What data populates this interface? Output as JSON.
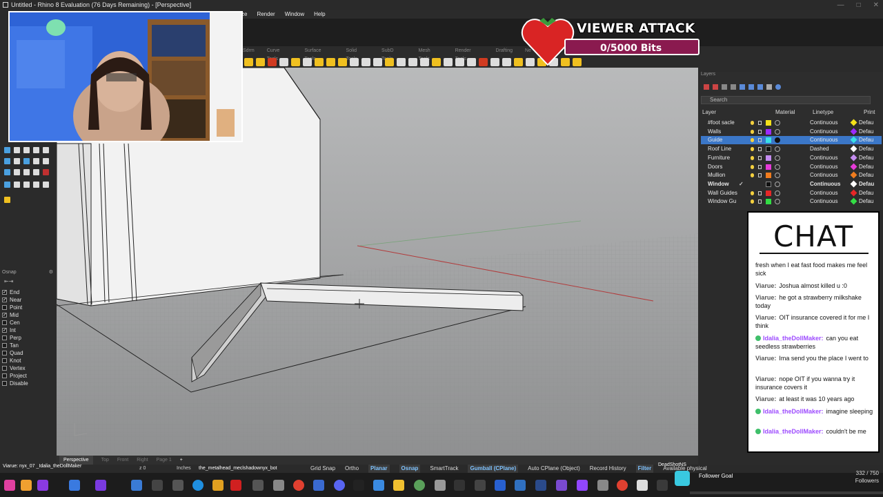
{
  "window": {
    "title": "Untitled - Rhino 8 Evaluation (76 Days Remaining) - [Perspective]"
  },
  "menu": [
    "ze",
    "Render",
    "Window",
    "Help"
  ],
  "tabs": [
    "Sdrm",
    "Curve Tools",
    "Surface Tools",
    "Solid Tools",
    "SubD Tools",
    "Mesh Tools",
    "Render Tools",
    "Drafting",
    "Ne"
  ],
  "osnap": {
    "title": "Osnap",
    "items": [
      {
        "label": "End",
        "checked": true
      },
      {
        "label": "Near",
        "checked": true
      },
      {
        "label": "Point",
        "checked": false
      },
      {
        "label": "Mid",
        "checked": true
      },
      {
        "label": "Cen",
        "checked": false
      },
      {
        "label": "Int",
        "checked": true
      },
      {
        "label": "Perp",
        "checked": false
      },
      {
        "label": "Tan",
        "checked": false
      },
      {
        "label": "Quad",
        "checked": false
      },
      {
        "label": "Knot",
        "checked": false
      },
      {
        "label": "Vertex",
        "checked": false
      },
      {
        "label": "Project",
        "checked": false
      },
      {
        "label": "Disable",
        "checked": false
      }
    ]
  },
  "layers": {
    "title": "Layers",
    "search_placeholder": "Search",
    "columns": {
      "layer": "Layer",
      "material": "Material",
      "linetype": "Linetype",
      "print": "Print"
    },
    "rows": [
      {
        "name": "#foot sacle",
        "color": "#f5e11a",
        "linetype": "Continuous",
        "print_color": "#f5e11a",
        "print": "Defau",
        "selected": false
      },
      {
        "name": "Walls",
        "color": "#9b2bff",
        "linetype": "Continuous",
        "print_color": "#9b2bff",
        "print": "Defau",
        "selected": false
      },
      {
        "name": "Guide",
        "color": "#39e0e6",
        "linetype": "Continuous",
        "print_color": "#39e0e6",
        "print": "Defau",
        "selected": true
      },
      {
        "name": "Roof Line",
        "color": "#111111",
        "linetype": "Dashed",
        "print_color": "#ffffff",
        "print": "Defau",
        "selected": false
      },
      {
        "name": "Furniture",
        "color": "#c48cf0",
        "linetype": "Continuous",
        "print_color": "#c48cf0",
        "print": "Defau",
        "selected": false
      },
      {
        "name": "Doors",
        "color": "#e63ad8",
        "linetype": "Continuous",
        "print_color": "#e63ad8",
        "print": "Defau",
        "selected": false
      },
      {
        "name": "Mullion",
        "color": "#f07c1e",
        "linetype": "Continuous",
        "print_color": "#f07c1e",
        "print": "Defau",
        "selected": false
      },
      {
        "name": "Window",
        "color": "#111111",
        "linetype": "Continuous",
        "print_color": "#ffffff",
        "print": "Defau",
        "selected": false,
        "bold": true
      },
      {
        "name": "Wall Guides",
        "color": "#e62727",
        "linetype": "Continuous",
        "print_color": "#e62727",
        "print": "Defau",
        "selected": false
      },
      {
        "name": "Window Gu",
        "color": "#33dd44",
        "linetype": "Continuous",
        "print_color": "#33dd44",
        "print": "Defau",
        "selected": false
      }
    ]
  },
  "viewport_tabs": {
    "active": "Perspective",
    "others": [
      "Top",
      "Front",
      "Right",
      "Page 1"
    ]
  },
  "status": {
    "units": "Inches",
    "z": "z 0",
    "layer_name": "the_metalhead_meclshadownyx_bot",
    "buttons": [
      {
        "label": "Grid Snap",
        "on": false
      },
      {
        "label": "Ortho",
        "on": false
      },
      {
        "label": "Planar",
        "on": true
      },
      {
        "label": "Osnap",
        "on": true
      },
      {
        "label": "SmartTrack",
        "on": false
      },
      {
        "label": "Gumball (CPlane)",
        "on": true
      },
      {
        "label": "Auto CPlane (Object)",
        "on": false
      },
      {
        "label": "Record History",
        "on": false
      },
      {
        "label": "Filter",
        "on": true
      },
      {
        "label": "Available physical",
        "on": false
      }
    ]
  },
  "overlay": {
    "viewer_attack_title": "VIEWER ATTACK",
    "viewer_attack_bits": "0/5000 Bits",
    "chat_title": "CHAT",
    "chat_messages": [
      {
        "user": "",
        "text": "fresh when I eat fast food makes me feel sick",
        "purple": false,
        "badge": false
      },
      {
        "user": "Viarue:",
        "text": "Joshua almost killed u :0",
        "purple": false,
        "badge": false
      },
      {
        "user": "Viarue:",
        "text": "he got a strawberry milkshake today",
        "purple": false,
        "badge": false
      },
      {
        "user": "Viarue:",
        "text": "OIT insurance covered it for me I think",
        "purple": false,
        "badge": false
      },
      {
        "user": "Idalia_theDollMaker:",
        "text": "can you eat seedless strawberries",
        "purple": true,
        "badge": true
      },
      {
        "user": "Viarue:",
        "text": "Ima send you the place I went to",
        "purple": false,
        "badge": false
      },
      {
        "user": "Viarue:",
        "text": "nope OIT if you wanna try it insurance covers it",
        "purple": false,
        "badge": false
      },
      {
        "user": "Viarue:",
        "text": "at least it was 10 years ago",
        "purple": false,
        "badge": false
      },
      {
        "user": "Idalia_theDollMaker:",
        "text": "imagine sleeping",
        "purple": true,
        "badge": true
      },
      {
        "user": "Idalia_theDollMaker:",
        "text": "couldn't be me",
        "purple": true,
        "badge": true
      }
    ],
    "follower_goal_label": "Follower Goal",
    "follower_count": "332 / 750",
    "follower_unit": "Followers",
    "deadshot": "DeadShotNS",
    "bottom_left": "Viarue: nyx_07 _Idalia_theDollMaker"
  }
}
